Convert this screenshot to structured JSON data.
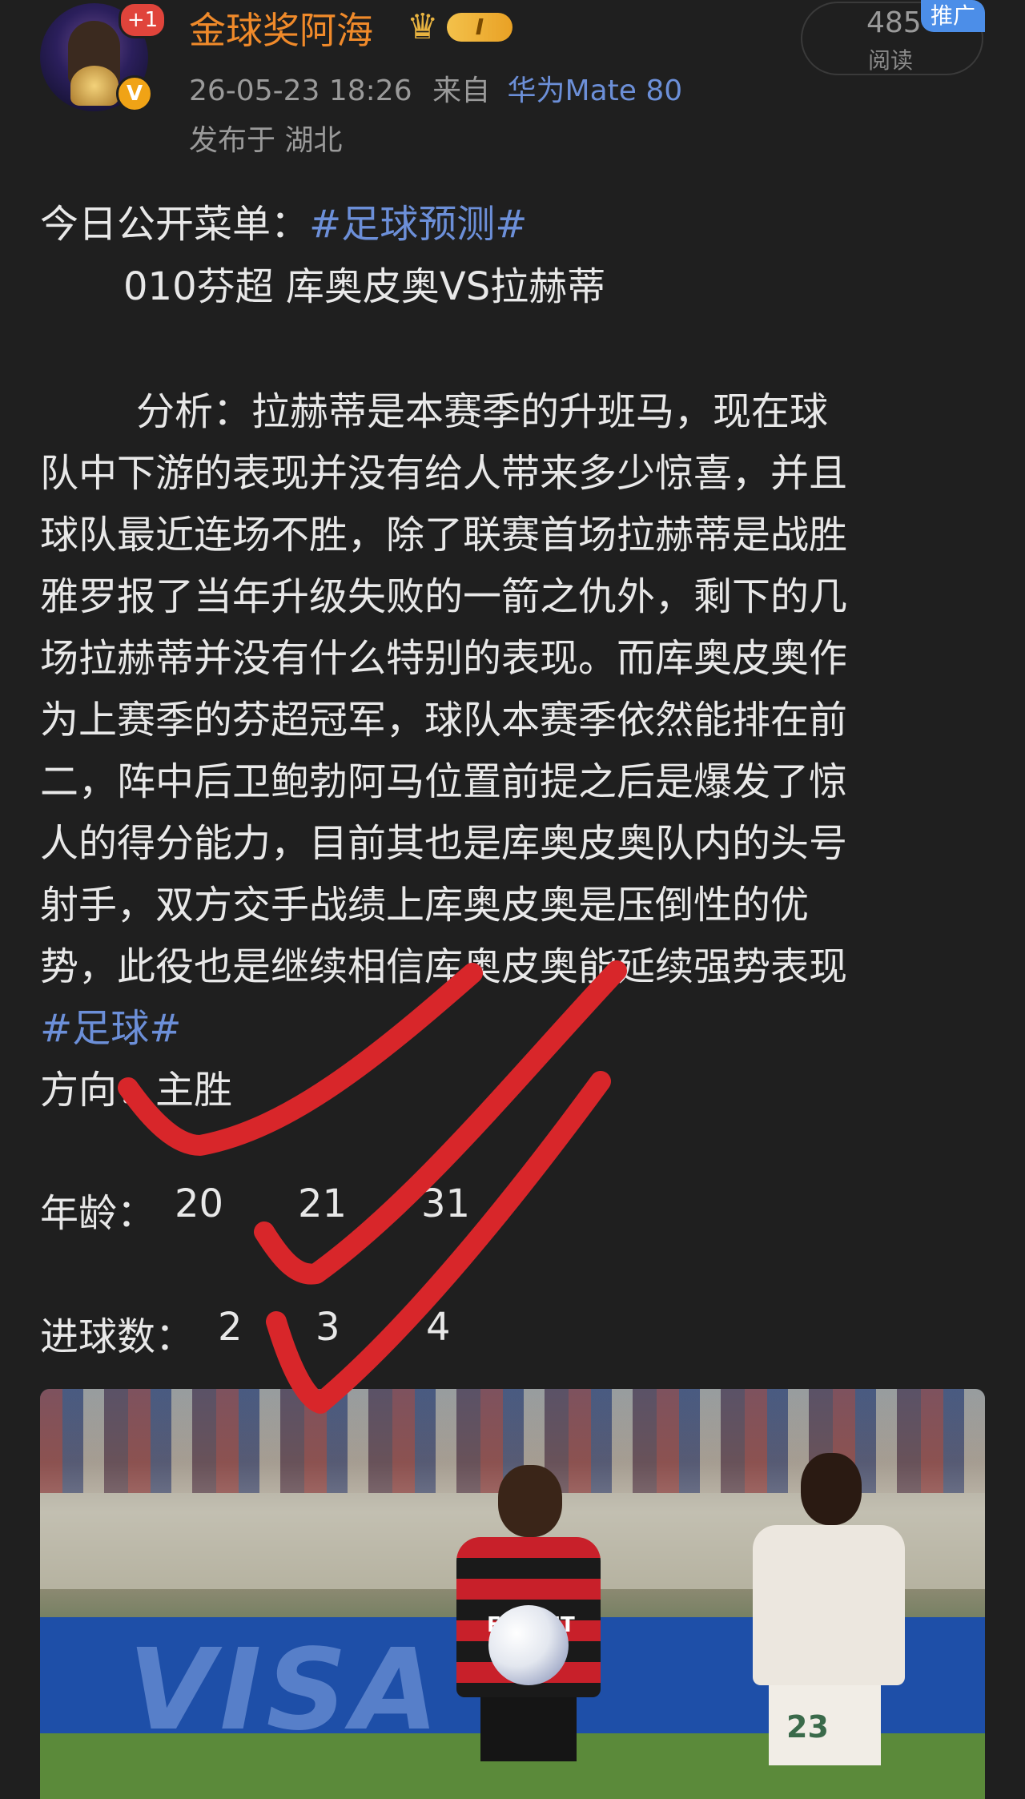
{
  "post": {
    "avatar_badge": "+1",
    "verified_icon": "V",
    "author": "金球奖阿海",
    "vip_level": "I",
    "timestamp": "26-05-23 18:26",
    "source_prefix": "来自",
    "device": "华为Mate 80",
    "location": "发布于 湖北",
    "read_count": "485",
    "read_label": "阅读",
    "promo_tag": "推广"
  },
  "content": {
    "intro_text": "今日公开菜单：",
    "topic_prediction": "#足球预测#",
    "match_line": "010芬超    库奥皮奥VS拉赫蒂",
    "analysis_lines": [
      "分析：拉赫蒂是本赛季的升班马，现在球",
      "队中下游的表现并没有给人带来多少惊喜，并且",
      "球队最近连场不胜，除了联赛首场拉赫蒂是战胜",
      "雅罗报了当年升级失败的一箭之仇外，剩下的几",
      "场拉赫蒂并没有什么特别的表现。而库奥皮奥作",
      "为上赛季的芬超冠军，球队本赛季依然能排在前",
      "二，阵中后卫鲍勃阿马位置前提之后是爆发了惊",
      "人的得分能力，目前其也是库奥皮奥队内的头号",
      "射手，双方交手战绩上库奥皮奥是压倒性的优",
      "势，此役也是继续相信库奥皮奥能延续强势表现"
    ],
    "topic_football": "#足球#",
    "direction": "方向：主胜",
    "age_label": "年龄：",
    "age_values": [
      "20",
      "21",
      "31"
    ],
    "goals_label": "进球数：",
    "goals_values": [
      "2",
      "3",
      "4"
    ]
  },
  "photo": {
    "board_text": "VISA",
    "sponsor_text": "FLABET",
    "player_number": "23"
  },
  "colors": {
    "background": "#1f1f1f",
    "username": "#f08a2a",
    "link": "#6c8fd8",
    "check_marks": "#d8262a"
  }
}
